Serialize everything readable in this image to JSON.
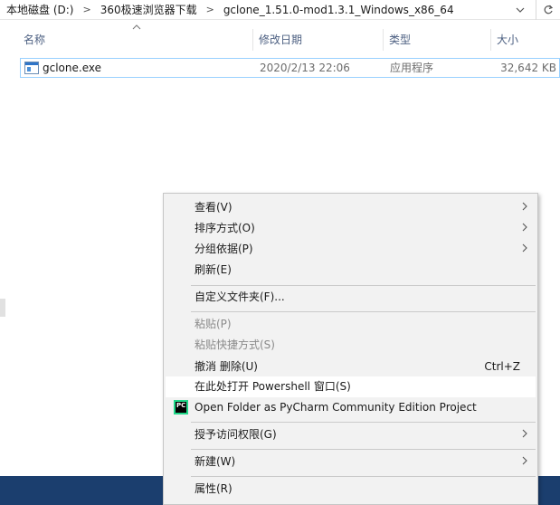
{
  "breadcrumb": [
    "本地磁盘 (D:)",
    "360极速浏览器下载",
    "gclone_1.51.0-mod1.3.1_Windows_x86_64"
  ],
  "breadcrumb_separator": ">",
  "icons": {
    "address_dropdown": "chevron-down-icon",
    "refresh": "refresh-icon",
    "sort": "sort-up-icon",
    "file": "exe-file-icon",
    "pycharm": "pycharm-icon",
    "submenu": "chevron-right-icon"
  },
  "columns": {
    "name": "名称",
    "date": "修改日期",
    "type": "类型",
    "size": "大小"
  },
  "files": [
    {
      "name": "gclone.exe",
      "date": "2020/2/13 22:06",
      "type": "应用程序",
      "size": "32,642 KB"
    }
  ],
  "context_menu": {
    "view": "查看(V)",
    "sort": "排序方式(O)",
    "group": "分组依据(P)",
    "refresh": "刷新(E)",
    "customize": "自定义文件夹(F)...",
    "paste": "粘贴(P)",
    "paste_shortcut": "粘贴快捷方式(S)",
    "undo": "撤消 删除(U)",
    "undo_shortcut": "Ctrl+Z",
    "powershell": "在此处打开 Powershell 窗口(S)",
    "pycharm": "Open Folder as PyCharm Community Edition Project",
    "grant_access": "授予访问权限(G)",
    "new": "新建(W)",
    "properties": "属性(R)"
  },
  "colors": {
    "selection_border": "#99d1ff",
    "menu_background": "#f2f2f2",
    "taskbar": "#1b3e6e",
    "header_text": "#4d6082"
  }
}
